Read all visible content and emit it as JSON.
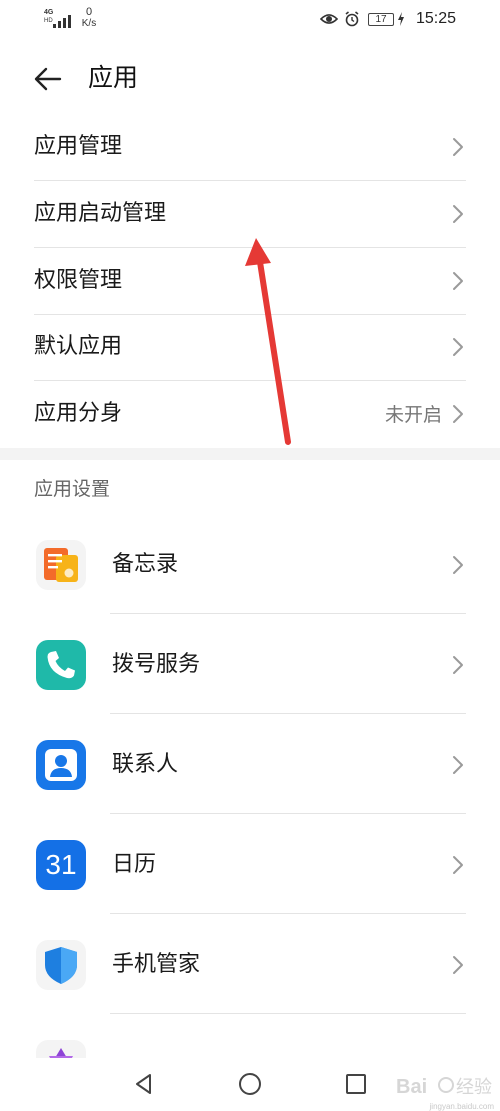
{
  "status_bar": {
    "network_type": "4G",
    "network_sub": "HD",
    "speed_value": "0",
    "speed_unit": "K/s",
    "battery_level": "17",
    "time": "15:25",
    "icons": [
      "signal-icon",
      "eye-icon",
      "alarm-icon",
      "battery-icon",
      "charging-icon"
    ]
  },
  "header": {
    "title": "应用",
    "back_icon": "back-arrow-icon"
  },
  "menu": {
    "items": [
      {
        "label": "应用管理",
        "value": ""
      },
      {
        "label": "应用启动管理",
        "value": ""
      },
      {
        "label": "权限管理",
        "value": ""
      },
      {
        "label": "默认应用",
        "value": ""
      },
      {
        "label": "应用分身",
        "value": "未开启"
      }
    ]
  },
  "app_settings": {
    "title": "应用设置",
    "apps": [
      {
        "label": "备忘录",
        "icon": "notes-icon"
      },
      {
        "label": "拨号服务",
        "icon": "phone-icon"
      },
      {
        "label": "联系人",
        "icon": "contacts-icon"
      },
      {
        "label": "日历",
        "icon": "calendar-icon",
        "icon_text": "31"
      },
      {
        "label": "手机管家",
        "icon": "shield-icon"
      },
      {
        "label": "",
        "icon": "partial-app-icon"
      }
    ]
  },
  "navbar": {
    "buttons": [
      "back-triangle-icon",
      "home-circle-icon",
      "recents-square-icon"
    ]
  },
  "annotation": {
    "arrow_color": "#e53935"
  },
  "watermark": {
    "url": "jingyan.baidu.com"
  },
  "colors": {
    "accent_red": "#e53935",
    "section_gap": "#f3f3f3"
  }
}
